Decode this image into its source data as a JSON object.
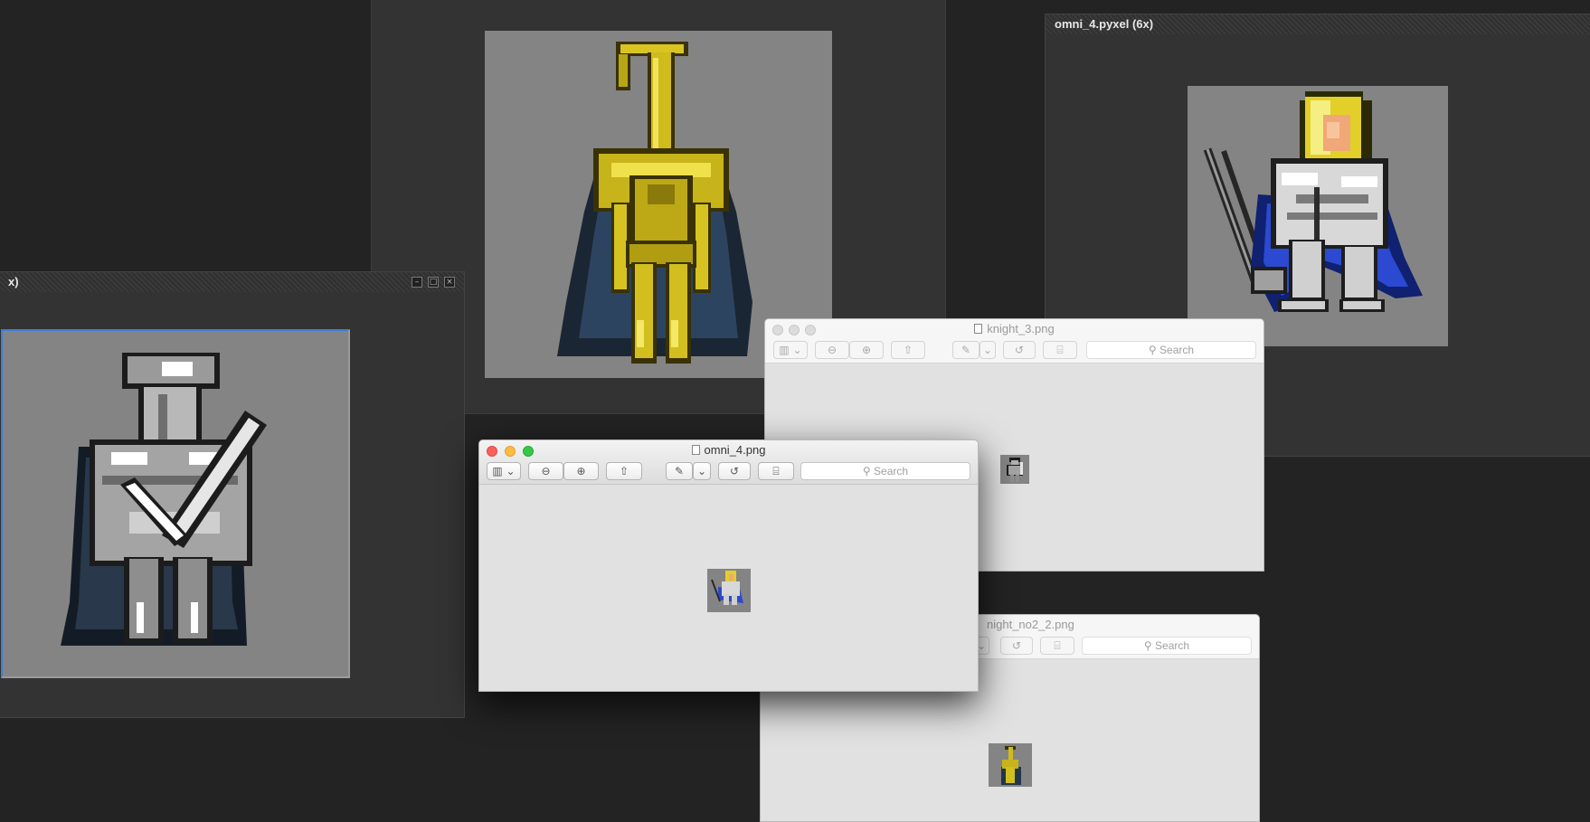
{
  "pyxel_windows": {
    "left": {
      "title": "x)",
      "min_label": "–",
      "max_label": "□",
      "close_label": "×"
    },
    "right": {
      "title": "omni_4.pyxel   (6x)"
    }
  },
  "preview_windows": {
    "knight3": {
      "title": "knight_3.png",
      "search_placeholder": "Search"
    },
    "omni4": {
      "title": "omni_4.png",
      "search_placeholder": "Search"
    },
    "knight_no2": {
      "title": "night_no2_2.png",
      "search_placeholder": "Search"
    }
  },
  "toolbar_icons": {
    "sidebar": "▥ ⌄",
    "zoom_out": "⊖",
    "zoom_in": "⊕",
    "share": "⇧",
    "markup": "✎",
    "markup_menu": "⌄",
    "rotate": "↺",
    "toolbox": "⌸",
    "search_glyph": "⚲"
  },
  "colors": {
    "gold": "#c9b418",
    "gold_dark": "#8a7a0c",
    "cape": "#23354a",
    "silver": "#d8d8d8",
    "steel": "#5a5a5a",
    "blue_cape": "#1e3aa8",
    "hair": "#e2cf2a",
    "skin": "#f0a878",
    "selection": "#3c7dd9"
  }
}
